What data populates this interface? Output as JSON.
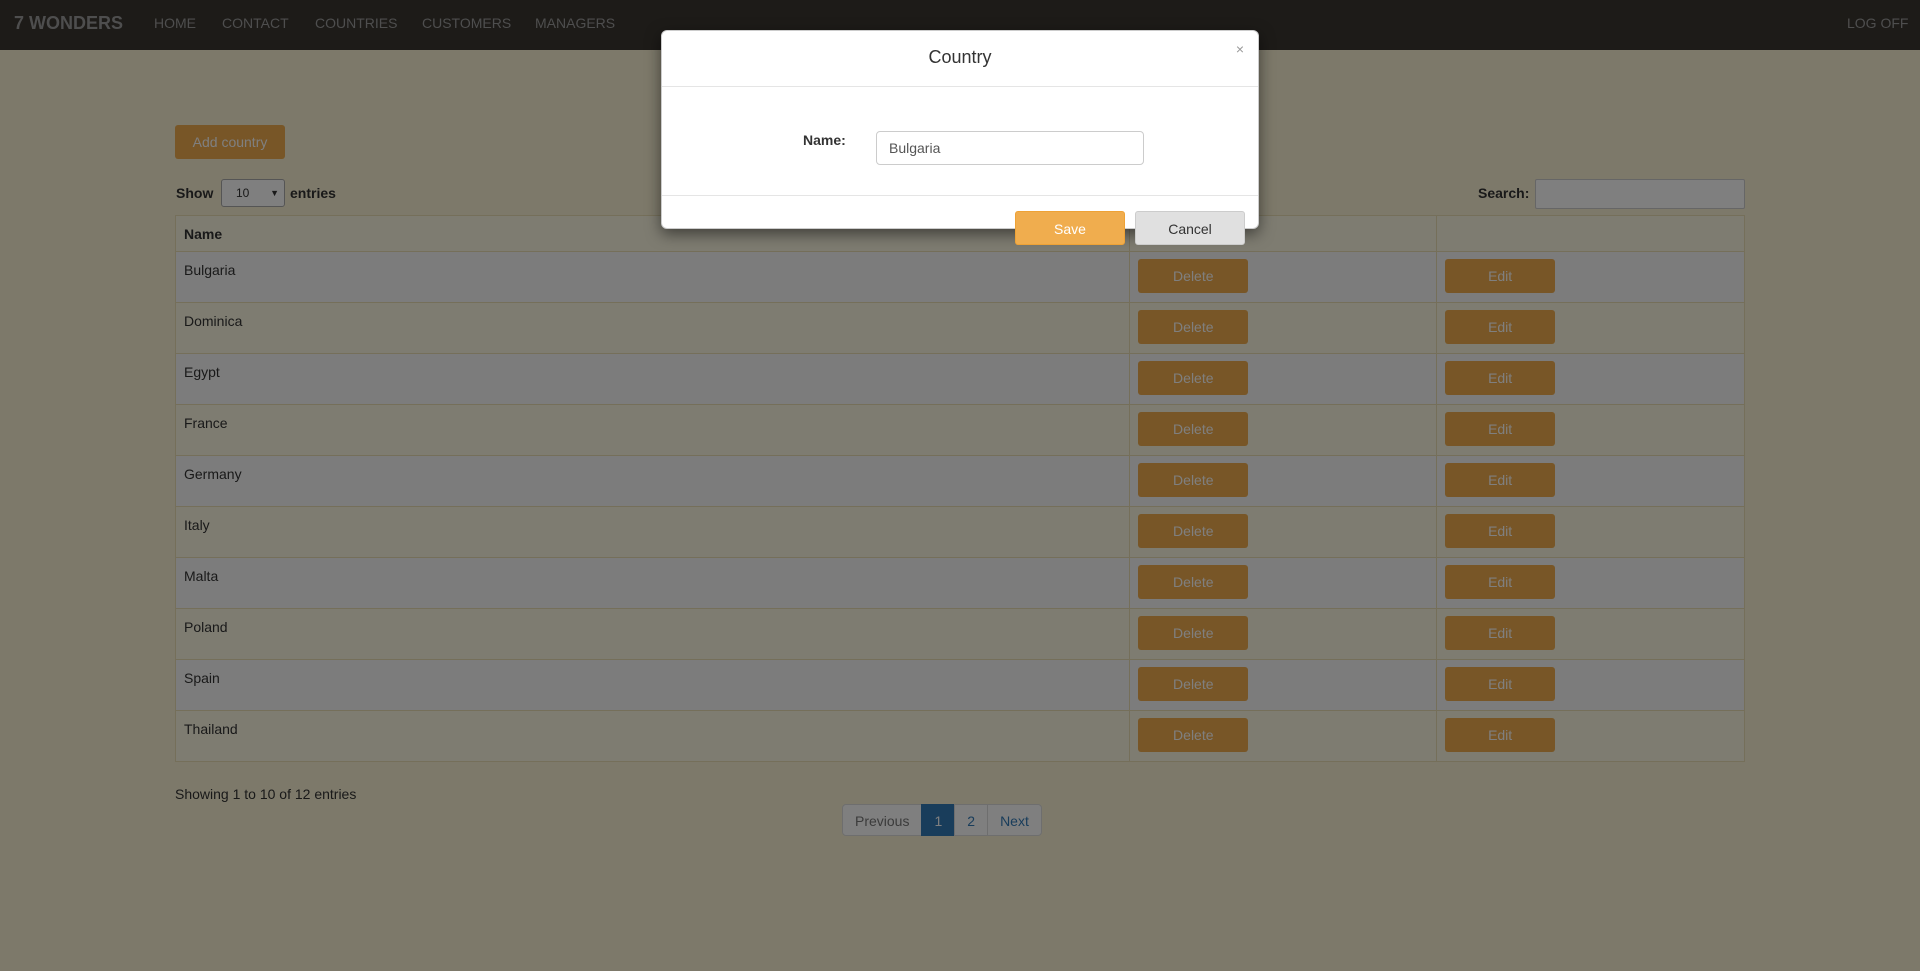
{
  "navbar": {
    "brand": "7 WONDERS",
    "links": [
      "HOME",
      "CONTACT",
      "COUNTRIES",
      "CUSTOMERS",
      "MANAGERS"
    ],
    "logoff": "LOG OFF"
  },
  "page": {
    "add_button": "Add country",
    "show_label": "Show",
    "entries_value": "10",
    "entries_label": "entries",
    "search_label": "Search:",
    "search_value": "",
    "columns": [
      "Name",
      "",
      ""
    ],
    "rows": [
      {
        "name": "Bulgaria",
        "delete": "Delete",
        "edit": "Edit"
      },
      {
        "name": "Dominica",
        "delete": "Delete",
        "edit": "Edit"
      },
      {
        "name": "Egypt",
        "delete": "Delete",
        "edit": "Edit"
      },
      {
        "name": "France",
        "delete": "Delete",
        "edit": "Edit"
      },
      {
        "name": "Germany",
        "delete": "Delete",
        "edit": "Edit"
      },
      {
        "name": "Italy",
        "delete": "Delete",
        "edit": "Edit"
      },
      {
        "name": "Malta",
        "delete": "Delete",
        "edit": "Edit"
      },
      {
        "name": "Poland",
        "delete": "Delete",
        "edit": "Edit"
      },
      {
        "name": "Spain",
        "delete": "Delete",
        "edit": "Edit"
      },
      {
        "name": "Thailand",
        "delete": "Delete",
        "edit": "Edit"
      }
    ],
    "info": "Showing 1 to 10 of 12 entries",
    "pagination": {
      "previous": "Previous",
      "pages": [
        "1",
        "2"
      ],
      "active_page": "1",
      "next": "Next"
    }
  },
  "modal": {
    "title": "Country",
    "close_glyph": "×",
    "name_label": "Name:",
    "name_value": "Bulgaria",
    "save": "Save",
    "cancel": "Cancel"
  },
  "colors": {
    "accent": "#f0ad4e",
    "navbar": "#3a3630",
    "page_bg": "#fbf3d5",
    "pagination_active": "#337ab7"
  }
}
